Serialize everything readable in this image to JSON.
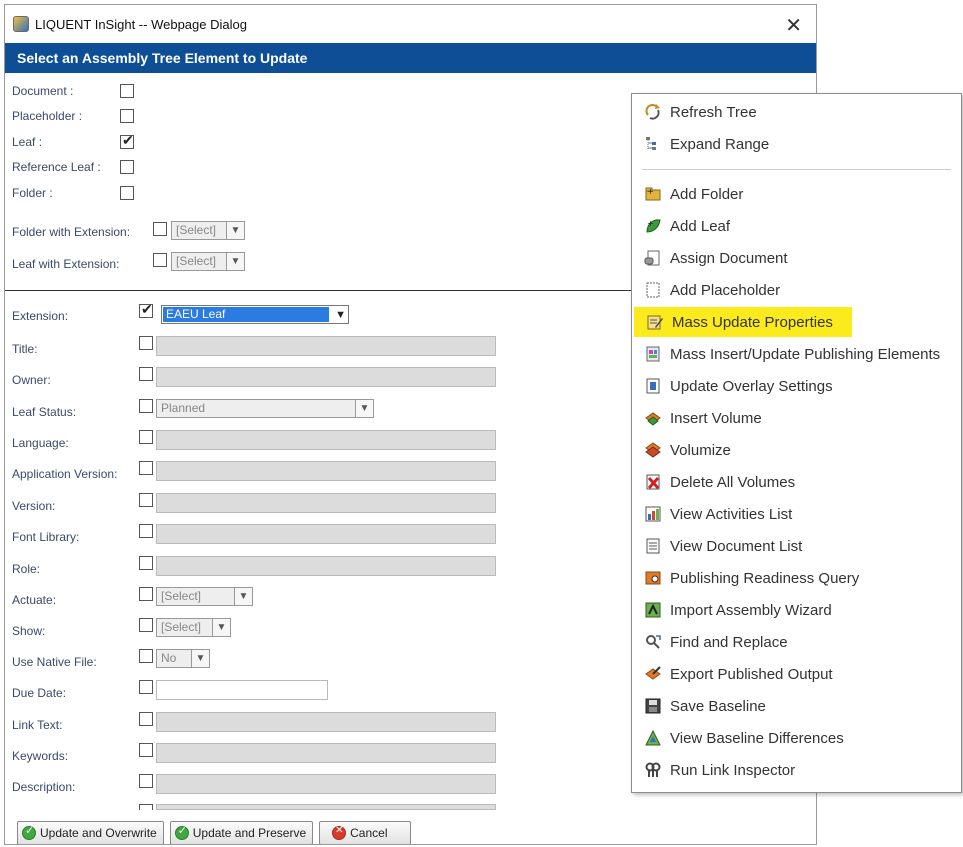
{
  "dialog": {
    "title": "LIQUENT InSight -- Webpage Dialog",
    "close_glyph": "✕",
    "header": "Select an Assembly Tree Element to Update"
  },
  "type_filters": [
    {
      "label": "Document :",
      "checked": false
    },
    {
      "label": "Placeholder :",
      "checked": false
    },
    {
      "label": "Leaf :",
      "checked": true
    },
    {
      "label": "Reference Leaf :",
      "checked": false
    },
    {
      "label": "Folder :",
      "checked": false
    }
  ],
  "extension_filters": {
    "folder_label": "Folder with Extension:",
    "folder_select": "[Select]",
    "leaf_label": "Leaf with Extension:",
    "leaf_select": "[Select]"
  },
  "fields": {
    "extension": {
      "label": "Extension:",
      "value": "EAEU Leaf"
    },
    "title": {
      "label": "Title:"
    },
    "owner": {
      "label": "Owner:"
    },
    "leaf_status": {
      "label": "Leaf Status:",
      "value": "Planned"
    },
    "language": {
      "label": "Language:"
    },
    "application_version": {
      "label": "Application Version:"
    },
    "version": {
      "label": "Version:"
    },
    "font_library": {
      "label": "Font Library:"
    },
    "role": {
      "label": "Role:"
    },
    "actuate": {
      "label": "Actuate:",
      "value": "[Select]"
    },
    "show": {
      "label": "Show:",
      "value": "[Select]"
    },
    "use_native_file": {
      "label": "Use Native File:",
      "value": "No"
    },
    "due_date": {
      "label": "Due Date:"
    },
    "link_text": {
      "label": "Link Text:"
    },
    "keywords": {
      "label": "Keywords:"
    },
    "description": {
      "label": "Description:"
    }
  },
  "buttons": {
    "update_overwrite": "Update and Overwrite",
    "update_preserve": "Update and Preserve",
    "cancel": "Cancel"
  },
  "context_menu": {
    "items": [
      {
        "label": "Refresh Tree",
        "icon": "refresh-icon"
      },
      {
        "label": "Expand Range",
        "icon": "expand-range-icon"
      },
      {
        "label": "Add Folder",
        "icon": "add-folder-icon"
      },
      {
        "label": "Add Leaf",
        "icon": "add-leaf-icon"
      },
      {
        "label": "Assign Document",
        "icon": "assign-document-icon"
      },
      {
        "label": "Add Placeholder",
        "icon": "add-placeholder-icon"
      },
      {
        "label": "Mass Update Properties",
        "icon": "mass-update-icon",
        "highlighted": true
      },
      {
        "label": "Mass Insert/Update Publishing Elements",
        "icon": "mass-insert-icon"
      },
      {
        "label": "Update Overlay Settings",
        "icon": "overlay-settings-icon"
      },
      {
        "label": "Insert Volume",
        "icon": "insert-volume-icon"
      },
      {
        "label": "Volumize",
        "icon": "volumize-icon"
      },
      {
        "label": "Delete All Volumes",
        "icon": "delete-volumes-icon"
      },
      {
        "label": "View Activities List",
        "icon": "activities-list-icon"
      },
      {
        "label": "View Document List",
        "icon": "document-list-icon"
      },
      {
        "label": "Publishing Readiness Query",
        "icon": "readiness-query-icon"
      },
      {
        "label": "Import Assembly Wizard",
        "icon": "import-wizard-icon"
      },
      {
        "label": "Find and Replace",
        "icon": "find-replace-icon"
      },
      {
        "label": "Export Published Output",
        "icon": "export-output-icon"
      },
      {
        "label": "Save Baseline",
        "icon": "save-baseline-icon"
      },
      {
        "label": "View Baseline Differences",
        "icon": "baseline-diff-icon"
      },
      {
        "label": "Run Link Inspector",
        "icon": "link-inspector-icon"
      }
    ]
  },
  "colors": {
    "header_band": "#0d4e96",
    "highlight": "#fbeb1c",
    "selection": "#2a7be2"
  }
}
